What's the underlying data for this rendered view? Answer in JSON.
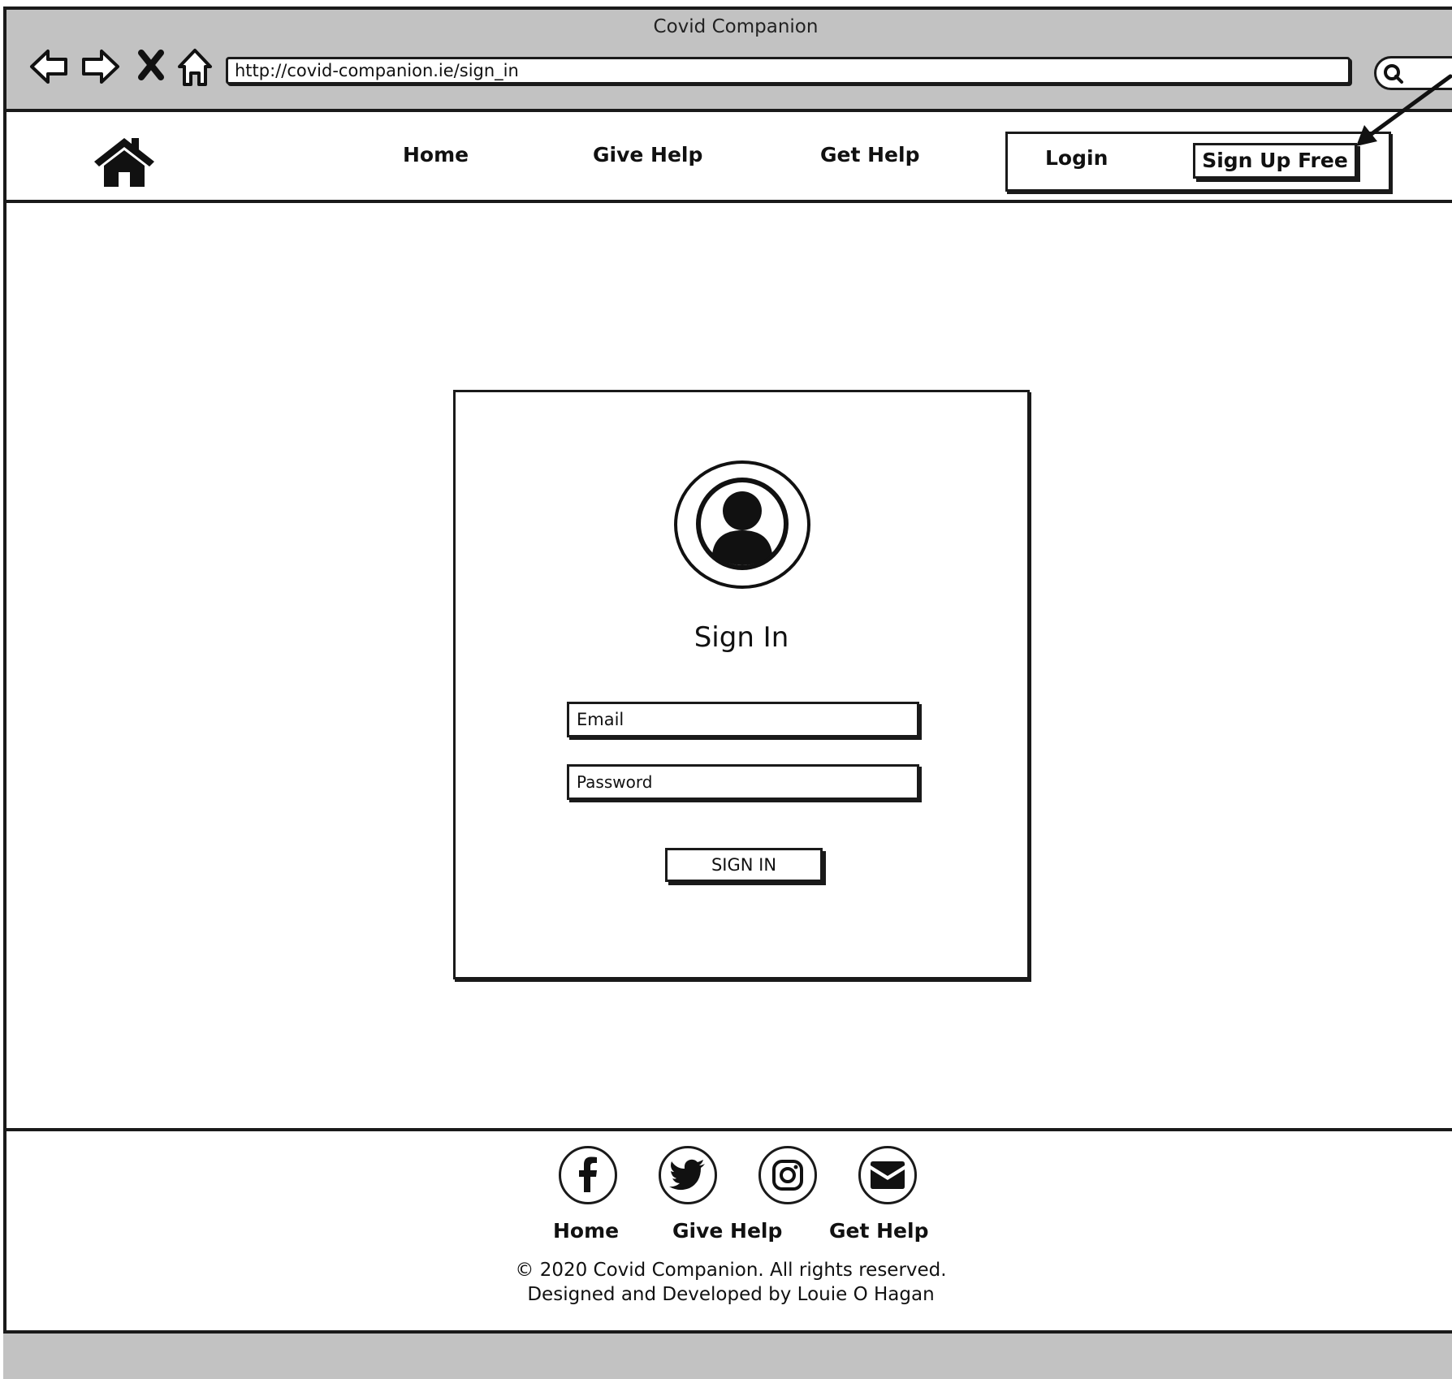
{
  "browser": {
    "title": "Covid Companion",
    "url": "http://covid-companion.ie/sign_in",
    "icons": [
      "back-arrow-icon",
      "forward-arrow-icon",
      "close-x-icon",
      "home-outline-icon",
      "search-icon"
    ]
  },
  "header": {
    "logo_icon": "house-icon",
    "nav": [
      "Home",
      "Give Help",
      "Get Help"
    ],
    "login_label": "Login",
    "signup_label": "Sign Up Free"
  },
  "signin": {
    "avatar_icon": "user-avatar-icon",
    "title": "Sign In",
    "email_placeholder": "Email",
    "password_placeholder": "Password",
    "button_label": "SIGN IN"
  },
  "footer": {
    "social_icons": [
      "facebook-icon",
      "twitter-icon",
      "instagram-icon",
      "envelope-icon"
    ],
    "links": [
      "Home",
      "Give Help",
      "Get Help"
    ],
    "copyright": "© 2020 Covid Companion. All rights reserved.",
    "credit": "Designed and Developed by Louie O Hagan"
  }
}
